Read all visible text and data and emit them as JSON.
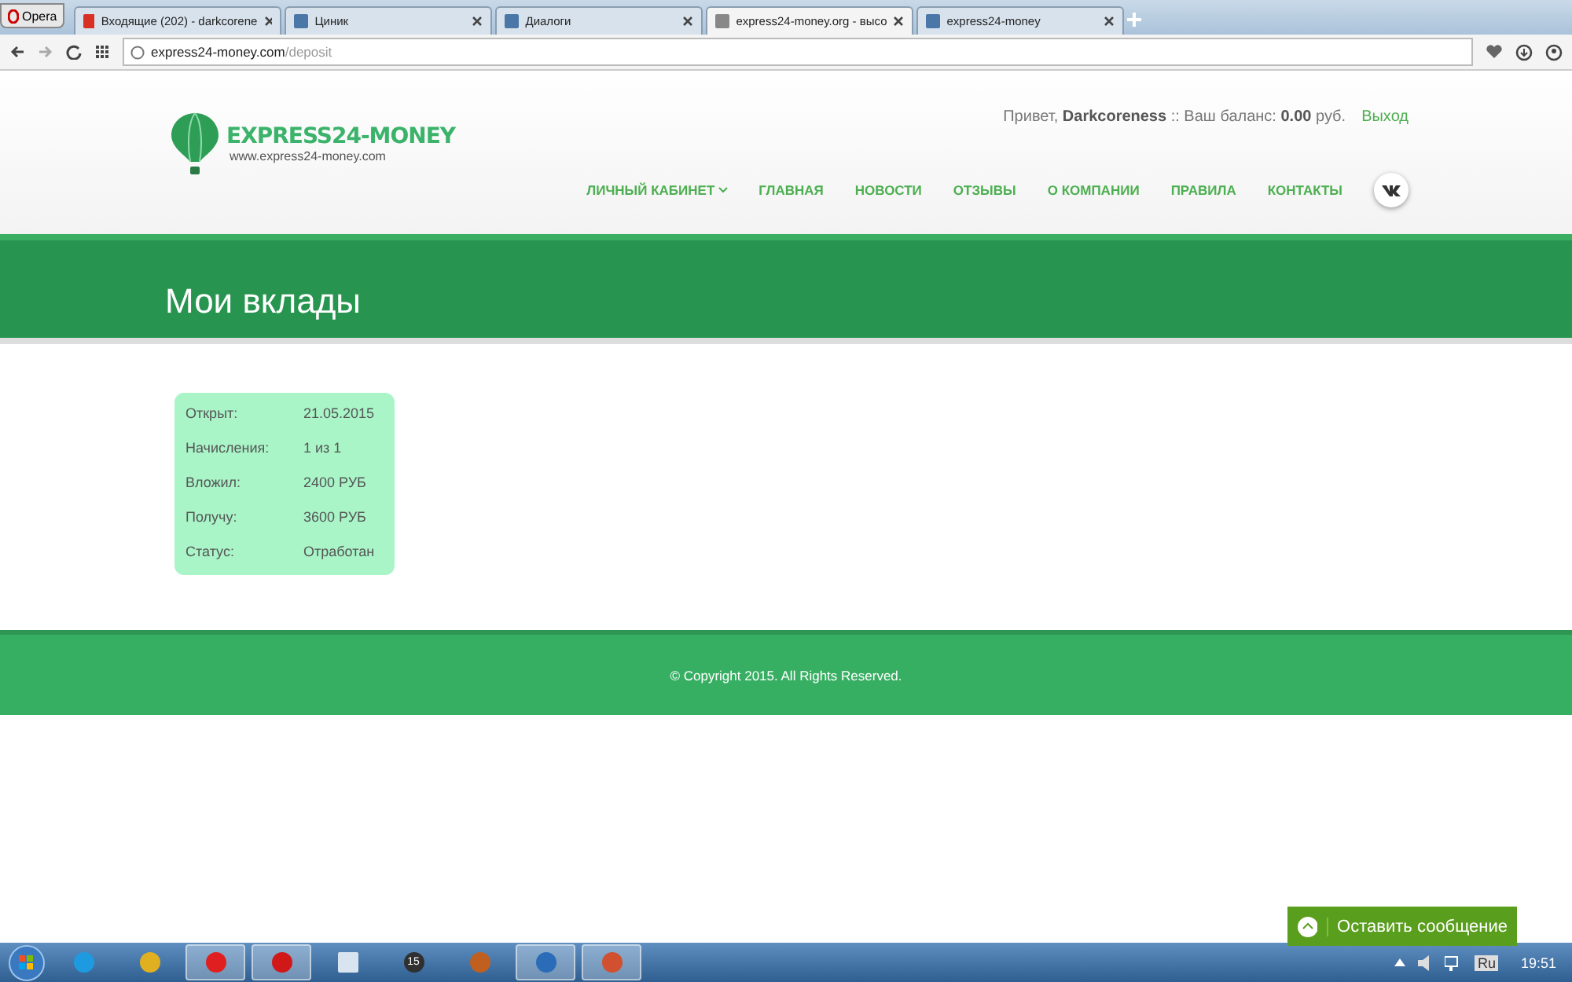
{
  "browser": {
    "menu_label": "Opera",
    "tabs": [
      {
        "kind": "mail",
        "label": "Входящие (202) - darkcorene",
        "selected": false
      },
      {
        "kind": "social",
        "label": "Циник",
        "selected": false
      },
      {
        "kind": "chat",
        "label": "Диалоги",
        "selected": false
      },
      {
        "kind": "page",
        "label": "express24-money.org - высо",
        "selected": true
      },
      {
        "kind": "social",
        "label": "express24-money",
        "selected": false
      }
    ],
    "address": {
      "host": "express24-money.com",
      "path": "/deposit"
    }
  },
  "site": {
    "logo": {
      "name": "EXPRESS24-MONEY",
      "url": "www.express24-money.com"
    },
    "greeting": "Привет, **Darkcoreness** :: Ваш баланс: **0.00** руб.",
    "logout": "Выход",
    "nav": [
      {
        "label": "ЛИЧНЫЙ КАБИНЕТ",
        "kind": "dropdown"
      },
      {
        "label": "ГЛАВНАЯ",
        "kind": "link"
      },
      {
        "label": "НОВОСТИ",
        "kind": "link"
      },
      {
        "label": "ОТЗЫВЫ",
        "kind": "link"
      },
      {
        "label": "О КОМПАНИИ",
        "kind": "link"
      },
      {
        "label": "ПРАВИЛА",
        "kind": "link"
      },
      {
        "label": "КОНТАКТЫ",
        "kind": "link"
      }
    ],
    "page_title": "Мои вклады",
    "deposit": [
      {
        "label": "Открыт:",
        "value": "21.05.2015"
      },
      {
        "label": "Начисления:",
        "value": "1 из 1"
      },
      {
        "label": "Вложил:",
        "value": "2400 РУБ"
      },
      {
        "label": "Получу:",
        "value": "3600 РУБ"
      },
      {
        "label": "Статус:",
        "value": "Отработан"
      }
    ],
    "footer": "© Copyright 2015. All Rights Reserved.",
    "chat_button": "Оставить сообщение"
  },
  "taskbar": {
    "apps": [
      {
        "kind": "skype",
        "color": "#1e9be0",
        "active": false
      },
      {
        "kind": "chrome",
        "color": "#e0b020",
        "active": false
      },
      {
        "kind": "yandex",
        "color": "#e02020",
        "active": true
      },
      {
        "kind": "opera",
        "color": "#d01818",
        "active": true
      },
      {
        "kind": "file",
        "color": "#d8e4f0",
        "active": false
      },
      {
        "kind": "badge",
        "color": "#303030",
        "active": false,
        "label": "15"
      },
      {
        "kind": "game",
        "color": "#c06020",
        "active": false
      },
      {
        "kind": "paint",
        "color": "#2a6cb8",
        "active": true
      },
      {
        "kind": "record",
        "color": "#d05030",
        "active": true
      }
    ],
    "lang": "Ru",
    "time": "19:51"
  }
}
